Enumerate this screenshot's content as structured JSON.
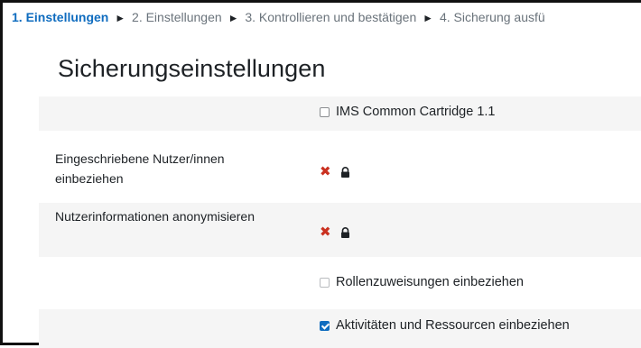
{
  "breadcrumb": {
    "steps": [
      "1. Einstellungen",
      "2. Einstellungen",
      "3. Kontrollieren und bestätigen",
      "4. Sicherung ausfü"
    ],
    "separator": "►"
  },
  "page": {
    "title": "Sicherungseinstellungen"
  },
  "settings": [
    {
      "label": "",
      "value_label": "IMS Common Cartridge 1.1",
      "type": "checkbox",
      "checked": false
    },
    {
      "label": "Eingeschriebene Nutzer/innen einbeziehen",
      "type": "locked-no",
      "icon": "x-icon",
      "lock": "lock-icon"
    },
    {
      "label": "Nutzerinformationen anonymisieren",
      "type": "locked-no",
      "icon": "x-icon",
      "lock": "lock-icon"
    },
    {
      "label": "",
      "value_label": "Rollenzuweisungen einbeziehen",
      "type": "checkbox",
      "checked": false,
      "disabled": true
    },
    {
      "label": "",
      "value_label": "Aktivitäten und Ressourcen einbeziehen",
      "type": "checkbox",
      "checked": true
    }
  ],
  "colors": {
    "accent": "#0f6cbf",
    "error": "#ca3120",
    "row_shade": "#f5f5f5"
  }
}
